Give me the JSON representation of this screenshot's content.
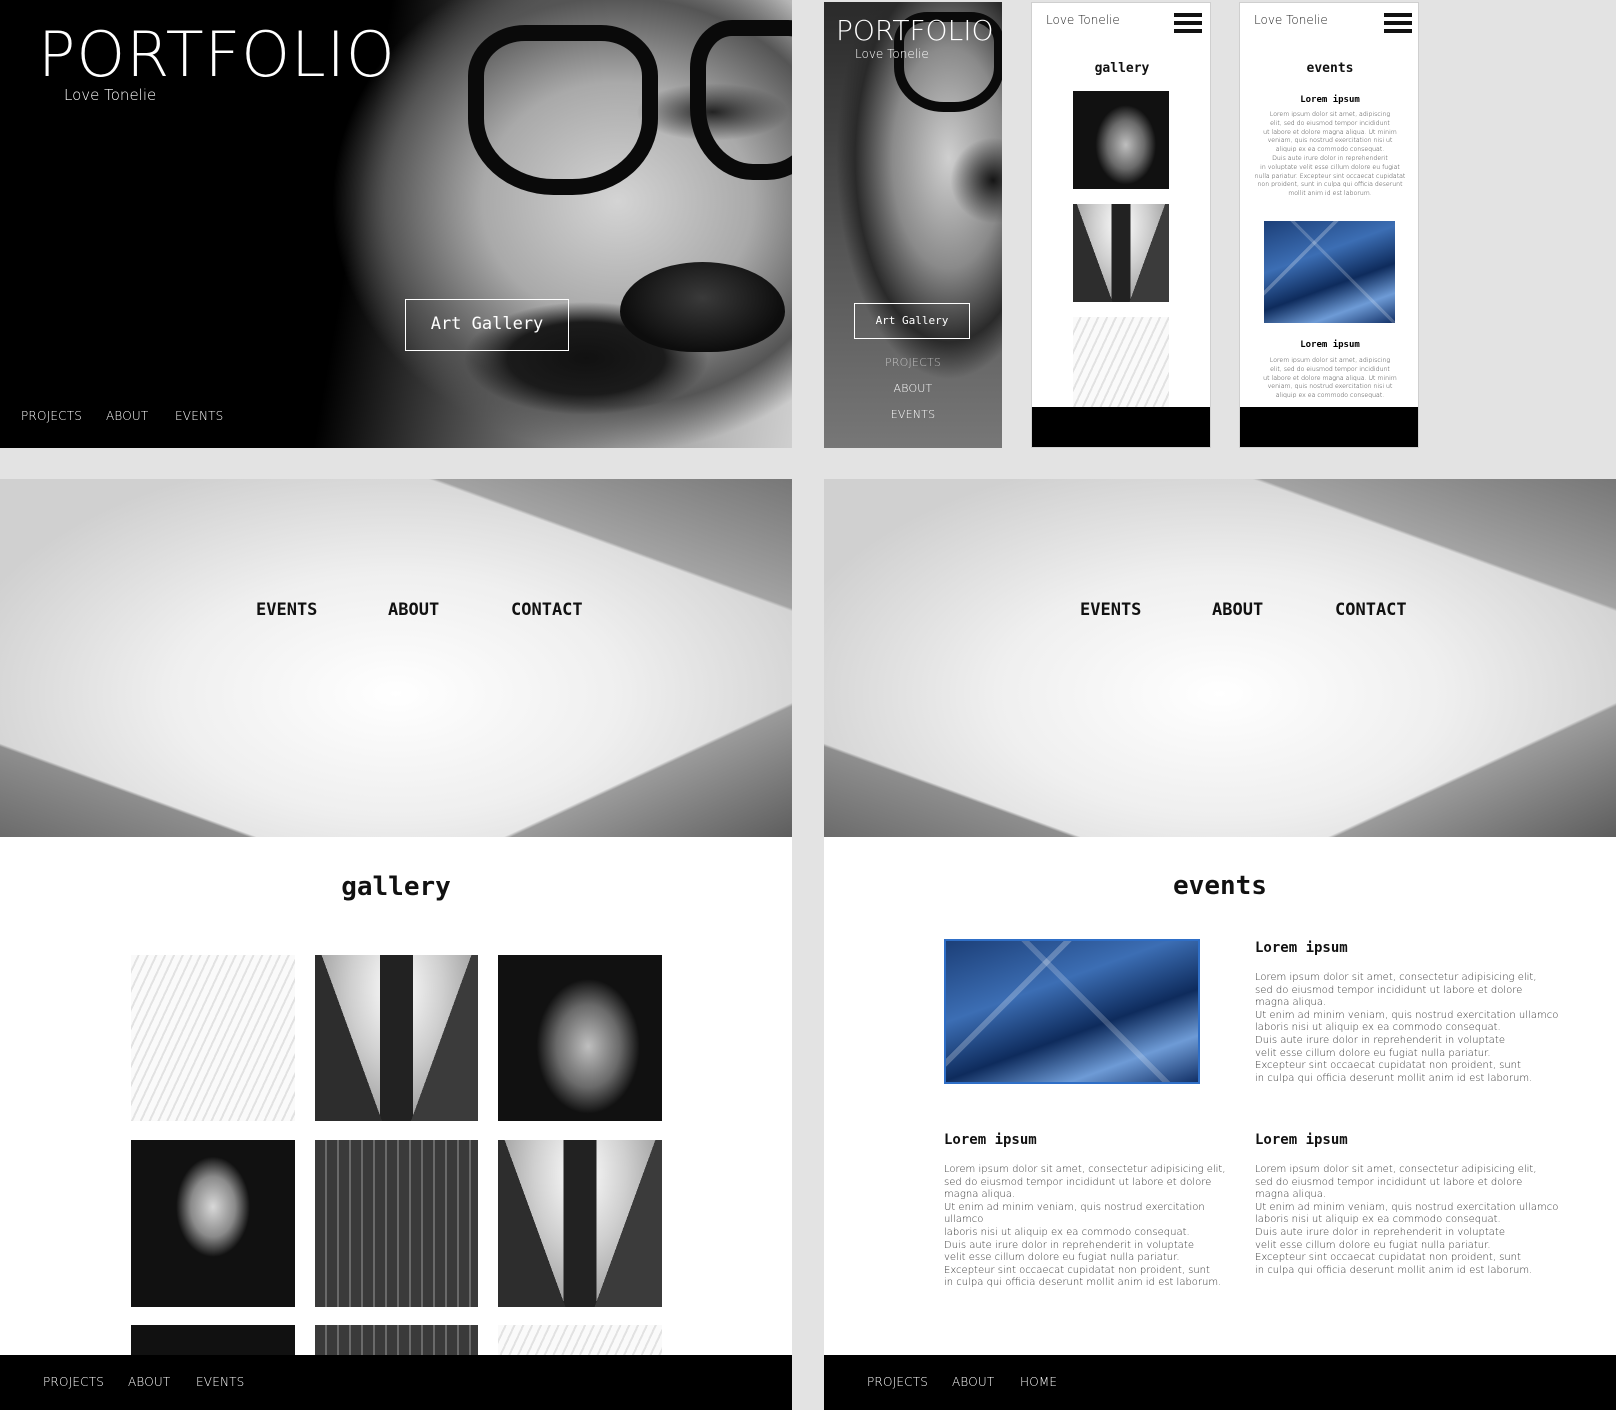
{
  "desktop_home": {
    "brand": "PORTFOLIO",
    "tagline": "Love Tonelie",
    "cta": "Art Gallery",
    "nav": [
      "PROJECTS",
      "ABOUT",
      "EVENTS"
    ]
  },
  "mobile_home": {
    "brand": "PORTFOLIO",
    "tagline": "Love Tonelie",
    "cta": "Art Gallery",
    "nav": [
      "PROJECTS",
      "ABOUT",
      "EVENTS"
    ]
  },
  "mobile_gallery": {
    "brand": "Love Tonelie",
    "title": "gallery"
  },
  "mobile_events": {
    "brand": "Love Tonelie",
    "title": "events",
    "heading1": "Lorem ipsum",
    "body1": "Lorem ipsum dolor sit amet, adipiscing\nelit, sed do eiusmod tempor incididunt\nut labore et dolore magna aliqua. Ut minim\nveniam, quis nostrud exercitation nisi ut\naliquip ex ea commodo consequat.\nDuis aute irure dolor in reprehenderit\nin voluptate velit esse cillum dolore eu fugiat\nnulla pariatur. Excepteur sint occaecat cupidatat\nnon proident, sunt in culpa qui officia deserunt\nmollit anim id est laborum.",
    "heading2": "Lorem ipsum",
    "body2": "Lorem ipsum dolor sit amet, adipiscing\nelit, sed do eiusmod tempor incididunt\nut labore et dolore magna aliqua. Ut minim\nveniam, quis nostrud exercitation nisi ut\naliquip ex ea commodo consequat."
  },
  "desktop_gallery": {
    "nav": [
      "EVENTS",
      "ABOUT",
      "CONTACT"
    ],
    "title": "gallery",
    "footer_nav": [
      "PROJECTS",
      "ABOUT",
      "EVENTS"
    ]
  },
  "desktop_events": {
    "nav": [
      "EVENTS",
      "ABOUT",
      "CONTACT"
    ],
    "title": "events",
    "items": [
      {
        "heading": "Lorem ipsum",
        "body": "Lorem ipsum dolor sit amet, consectetur adipisicing elit,\nsed do eiusmod tempor incididunt ut labore et dolore\nmagna aliqua.\nUt enim ad minim veniam, quis nostrud exercitation ullamco\nlaboris nisi ut aliquip ex ea commodo consequat.\nDuis aute irure dolor in reprehenderit in voluptate\nvelit esse cillum dolore eu fugiat nulla pariatur.\nExcepteur sint occaecat cupidatat non proident, sunt\nin culpa qui officia deserunt mollit anim id est laborum."
      },
      {
        "heading": "Lorem ipsum",
        "body": "Lorem ipsum dolor sit amet, consectetur adipisicing elit,\nsed do eiusmod tempor incididunt ut labore et dolore\nmagna aliqua.\nUt enim ad minim veniam, quis nostrud exercitation ullamco\nlaboris nisi ut aliquip ex ea commodo consequat.\nDuis aute irure dolor in reprehenderit in voluptate\nvelit esse cillum dolore eu fugiat nulla pariatur.\nExcepteur sint occaecat cupidatat non proident, sunt\nin culpa qui officia deserunt mollit anim id est laborum."
      },
      {
        "heading": "Lorem ipsum",
        "body": "Lorem ipsum dolor sit amet, consectetur adipisicing elit,\nsed do eiusmod tempor incididunt ut labore et dolore\nmagna aliqua.\nUt enim ad minim veniam, quis nostrud exercitation ullamco\nlaboris nisi ut aliquip ex ea commodo consequat.\nDuis aute irure dolor in reprehenderit in voluptate\nvelit esse cillum dolore eu fugiat nulla pariatur.\nExcepteur sint occaecat cupidatat non proident, sunt\nin culpa qui officia deserunt mollit anim id est laborum."
      }
    ],
    "footer_nav": [
      "PROJECTS",
      "ABOUT",
      "HOME"
    ]
  },
  "colors": {
    "background": "#e3e3e3",
    "dark": "#000000",
    "light": "#ffffff",
    "accent_blue": "#2f6fc7"
  }
}
